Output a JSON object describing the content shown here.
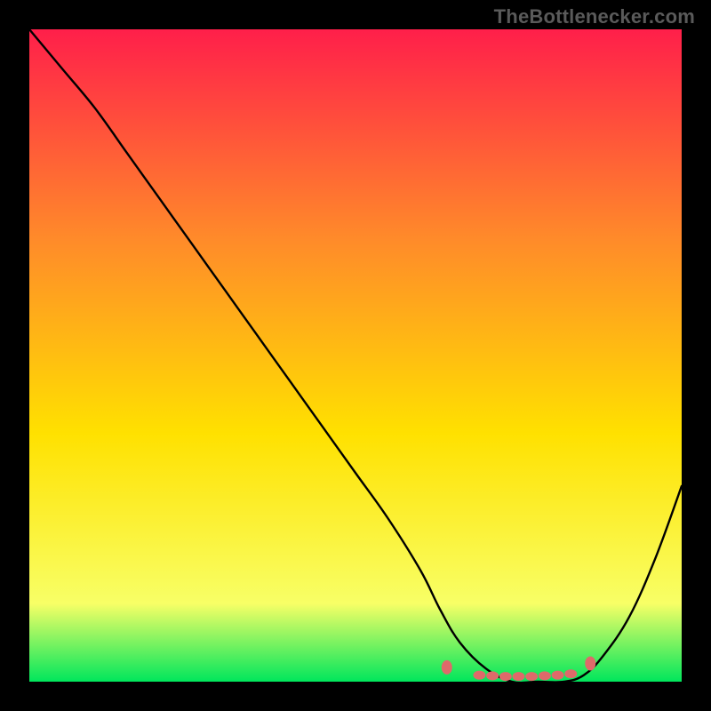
{
  "attribution": "TheBottlenecker.com",
  "chart_data": {
    "type": "line",
    "title": "",
    "xlabel": "",
    "ylabel": "",
    "xlim": [
      0,
      100
    ],
    "ylim": [
      0,
      100
    ],
    "background_gradient": {
      "top": "#ff1f4a",
      "mid_upper": "#ff8a2a",
      "mid": "#ffe100",
      "lower": "#f8ff66",
      "bottom": "#00e65c"
    },
    "series": [
      {
        "name": "bottleneck-curve",
        "x": [
          0,
          5,
          10,
          15,
          20,
          25,
          30,
          35,
          40,
          45,
          50,
          55,
          60,
          63,
          66,
          70,
          74,
          78,
          82,
          85,
          88,
          92,
          96,
          100
        ],
        "y": [
          100,
          94,
          88,
          81,
          74,
          67,
          60,
          53,
          46,
          39,
          32,
          25,
          17,
          11,
          6,
          2,
          0,
          0,
          0,
          1,
          4,
          10,
          19,
          30
        ]
      }
    ],
    "markers": {
      "name": "optimal-zone-dots",
      "color": "#de6a6a",
      "points": [
        {
          "x": 64,
          "y": 2.2
        },
        {
          "x": 69,
          "y": 1.0
        },
        {
          "x": 71,
          "y": 0.9
        },
        {
          "x": 73,
          "y": 0.8
        },
        {
          "x": 75,
          "y": 0.8
        },
        {
          "x": 77,
          "y": 0.8
        },
        {
          "x": 79,
          "y": 0.9
        },
        {
          "x": 81,
          "y": 1.0
        },
        {
          "x": 83,
          "y": 1.2
        },
        {
          "x": 86,
          "y": 2.8
        }
      ]
    }
  }
}
